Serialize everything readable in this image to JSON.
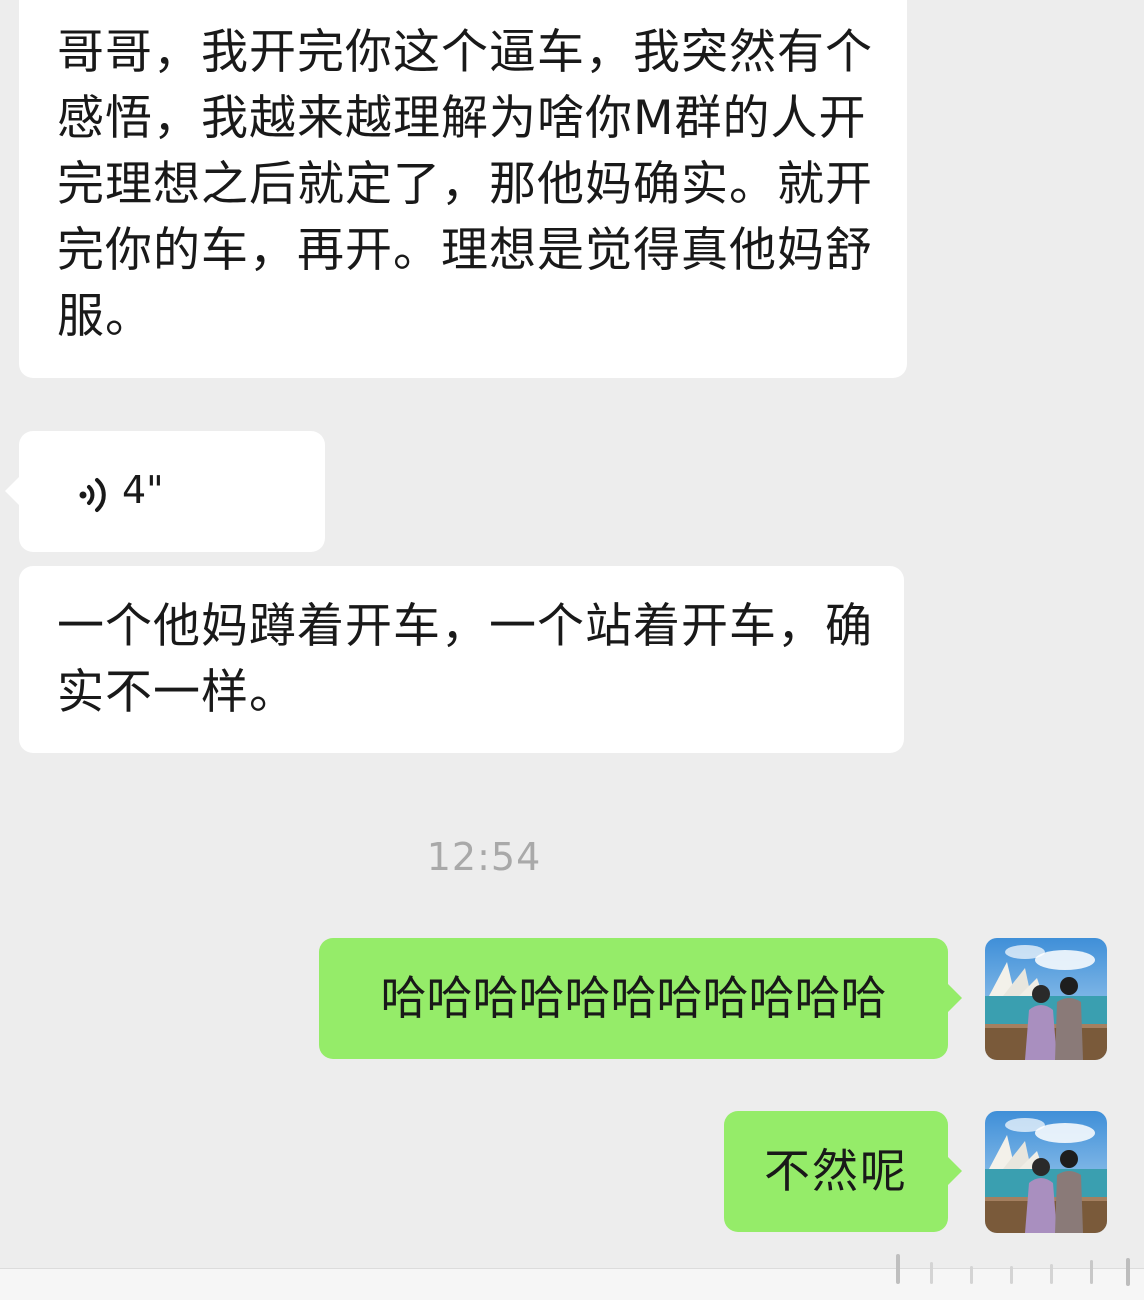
{
  "messages": {
    "incoming_1": {
      "text": "哥哥，我开完你这个逼车，我突然有个感悟，我越来越理解为啥你M群的人开完理想之后就定了，那他妈确实。就开完你的车，再开。理想是觉得真他妈舒服。"
    },
    "voice": {
      "duration": "4\"",
      "icon": "voice-wave-icon"
    },
    "incoming_2": {
      "text": "一个他妈蹲着开车，一个站着开车，确实不一样。"
    },
    "timestamp": "12:54",
    "outgoing_1": {
      "text": "哈哈哈哈哈哈哈哈哈哈哈"
    },
    "outgoing_2": {
      "text": "不然呢"
    }
  },
  "colors": {
    "background": "#ededed",
    "incoming_bubble": "#ffffff",
    "outgoing_bubble": "#95ec69",
    "timestamp": "#a9a9a9"
  }
}
